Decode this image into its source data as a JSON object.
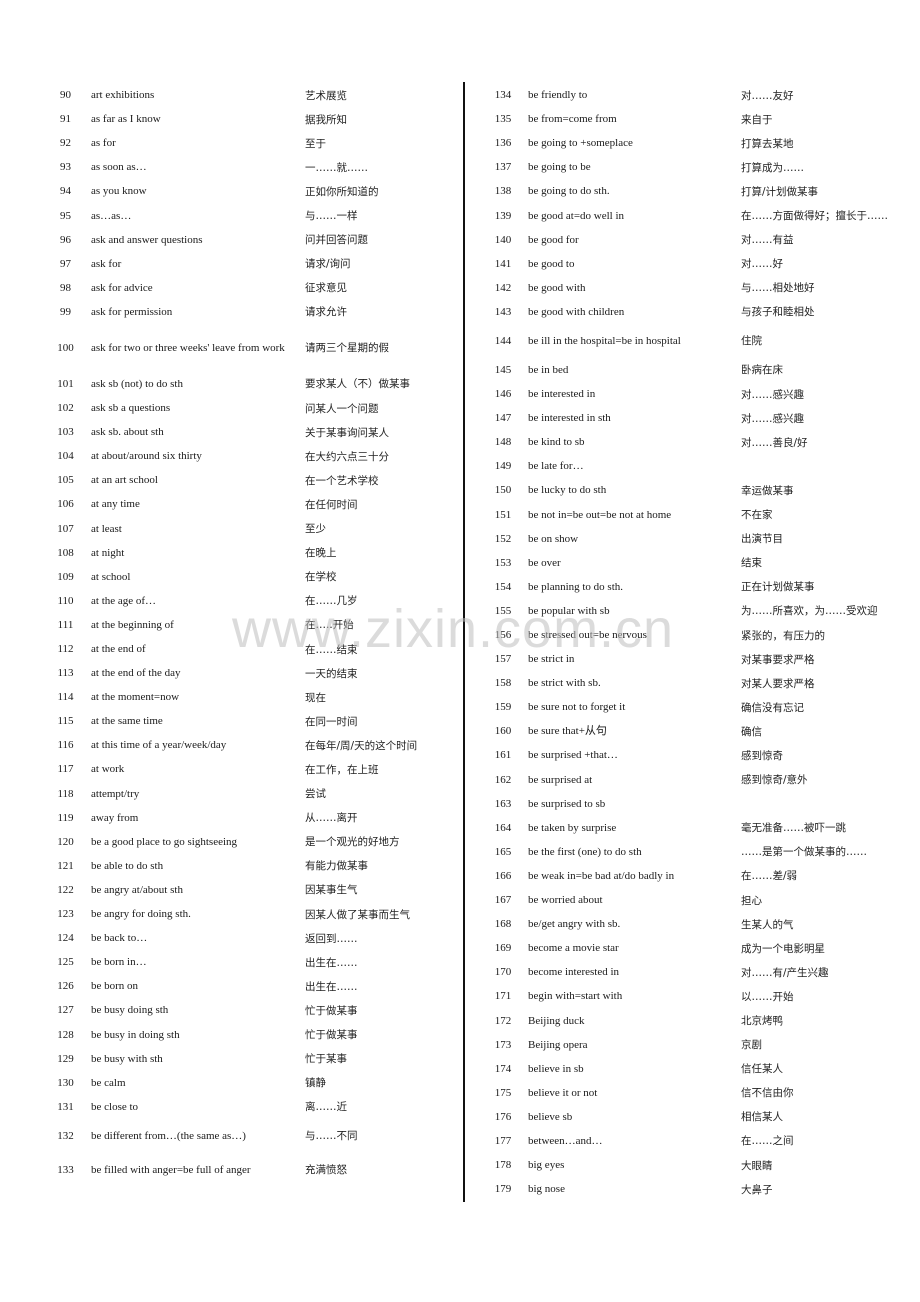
{
  "watermark": "www.zixin.com.cn",
  "left_column": [
    {
      "num": "90",
      "en": "art exhibitions",
      "zh": "艺术展览"
    },
    {
      "num": "91",
      "en": "as far as I know",
      "zh": "据我所知"
    },
    {
      "num": "92",
      "en": "as for",
      "zh": "至于"
    },
    {
      "num": "93",
      "en": "as soon as…",
      "zh": "一……就……"
    },
    {
      "num": "94",
      "en": "as you know",
      "zh": "正如你所知道的"
    },
    {
      "num": "95",
      "en": "as…as…",
      "zh": "与……一样"
    },
    {
      "num": "96",
      "en": "ask and answer questions",
      "zh": "问并回答问题"
    },
    {
      "num": "97",
      "en": "ask for",
      "zh": "请求/询问"
    },
    {
      "num": "98",
      "en": "ask for advice",
      "zh": "征求意见"
    },
    {
      "num": "99",
      "en": "ask for permission",
      "zh": "请求允许"
    },
    {
      "num": "100",
      "en": "ask for two or three weeks' leave from work",
      "zh": "请两三个星期的假",
      "tall": "tall2"
    },
    {
      "num": "101",
      "en": "ask sb (not) to do sth",
      "zh": "要求某人（不）做某事"
    },
    {
      "num": "102",
      "en": "ask sb a questions",
      "zh": "问某人一个问题"
    },
    {
      "num": "103",
      "en": "ask sb. about sth",
      "zh": "关于某事询问某人"
    },
    {
      "num": "104",
      "en": "at about/around six thirty",
      "zh": "在大约六点三十分"
    },
    {
      "num": "105",
      "en": "at an art school",
      "zh": "在一个艺术学校"
    },
    {
      "num": "106",
      "en": "at any time",
      "zh": "在任何时间"
    },
    {
      "num": "107",
      "en": "at least",
      "zh": "至少"
    },
    {
      "num": "108",
      "en": "at night",
      "zh": "在晚上"
    },
    {
      "num": "109",
      "en": "at school",
      "zh": "在学校"
    },
    {
      "num": "110",
      "en": "at the age of…",
      "zh": "在……几岁"
    },
    {
      "num": "111",
      "en": "at the beginning of",
      "zh": "在…..开始"
    },
    {
      "num": "112",
      "en": "at the end of",
      "zh": "在……结束"
    },
    {
      "num": "113",
      "en": "at the end of the day",
      "zh": "一天的结束"
    },
    {
      "num": "114",
      "en": "at the moment=now",
      "zh": "现在"
    },
    {
      "num": "115",
      "en": "at the same time",
      "zh": "在同一时间"
    },
    {
      "num": "116",
      "en": "at this time of a year/week/day",
      "zh": "在每年/周/天的这个时间"
    },
    {
      "num": "117",
      "en": "at work",
      "zh": "在工作，在上班"
    },
    {
      "num": "118",
      "en": "attempt/try",
      "zh": "尝试"
    },
    {
      "num": "119",
      "en": "away from",
      "zh": "从……离开"
    },
    {
      "num": "120",
      "en": "be a good place to go sightseeing",
      "zh": "是一个观光的好地方"
    },
    {
      "num": "121",
      "en": "be able to do sth",
      "zh": "有能力做某事"
    },
    {
      "num": "122",
      "en": "be angry at/about sth",
      "zh": "因某事生气"
    },
    {
      "num": "123",
      "en": "be angry for doing sth.",
      "zh": "因某人做了某事而生气"
    },
    {
      "num": "124",
      "en": "be back to…",
      "zh": "返回到……"
    },
    {
      "num": "125",
      "en": "be born in…",
      "zh": "出生在……"
    },
    {
      "num": "126",
      "en": "be born on",
      "zh": "出生在……"
    },
    {
      "num": "127",
      "en": "be busy doing sth",
      "zh": "忙于做某事"
    },
    {
      "num": "128",
      "en": "be busy in doing sth",
      "zh": "忙于做某事"
    },
    {
      "num": "129",
      "en": "be busy with sth",
      "zh": "忙于某事"
    },
    {
      "num": "130",
      "en": "be calm",
      "zh": "镇静"
    },
    {
      "num": "131",
      "en": "be close to",
      "zh": "离……近"
    },
    {
      "num": "132",
      "en": "be different from…(the same as…)",
      "zh": "与……不同",
      "tall": "tall1"
    },
    {
      "num": "133",
      "en": "be filled with anger=be full of anger",
      "zh": "充满愤怒",
      "tall": "tall1"
    }
  ],
  "right_column": [
    {
      "num": "134",
      "en": "be friendly to",
      "zh": "对……友好"
    },
    {
      "num": "135",
      "en": "be from=come from",
      "zh": "来自于"
    },
    {
      "num": "136",
      "en": "be going to +someplace",
      "zh": "打算去某地"
    },
    {
      "num": "137",
      "en": "be going to be",
      "zh": "打算成为……"
    },
    {
      "num": "138",
      "en": "be going to do sth.",
      "zh": "打算/计划做某事"
    },
    {
      "num": "139",
      "en": "be good at=do well in",
      "zh": "在……方面做得好；擅长于……"
    },
    {
      "num": "140",
      "en": "be good for",
      "zh": "对……有益"
    },
    {
      "num": "141",
      "en": "be good to",
      "zh": "对……好"
    },
    {
      "num": "142",
      "en": "be good with",
      "zh": "与……相处地好"
    },
    {
      "num": "143",
      "en": "be good with children",
      "zh": "与孩子和睦相处"
    },
    {
      "num": "144",
      "en": "be ill in the hospital=be in hospital",
      "zh": "住院",
      "tall": "tall1"
    },
    {
      "num": "145",
      "en": "be in bed",
      "zh": "卧病在床"
    },
    {
      "num": "146",
      "en": "be interested in",
      "zh": "对……感兴趣"
    },
    {
      "num": "147",
      "en": "be interested in sth",
      "zh": "对……感兴趣"
    },
    {
      "num": "148",
      "en": "be kind to sb",
      "zh": "对……善良/好"
    },
    {
      "num": "149",
      "en": "be late for…",
      "zh": ""
    },
    {
      "num": "150",
      "en": "be lucky to do sth",
      "zh": "幸运做某事"
    },
    {
      "num": "151",
      "en": "be not in=be out=be not at home",
      "zh": "不在家"
    },
    {
      "num": "152",
      "en": "be on show",
      "zh": "出演节目"
    },
    {
      "num": "153",
      "en": "be over",
      "zh": "结束"
    },
    {
      "num": "154",
      "en": "be planning to do sth.",
      "zh": "正在计划做某事"
    },
    {
      "num": "155",
      "en": "be popular with sb",
      "zh": "为……所喜欢，为……受欢迎"
    },
    {
      "num": "156",
      "en": "be stressed out=be nervous",
      "zh": "紧张的，有压力的"
    },
    {
      "num": "157",
      "en": "be strict in",
      "zh": "对某事要求严格"
    },
    {
      "num": "158",
      "en": "be strict with sb.",
      "zh": "对某人要求严格"
    },
    {
      "num": "159",
      "en": "be sure not to forget it",
      "zh": "确信没有忘记"
    },
    {
      "num": "160",
      "en": "be sure that+从句",
      "zh": "确信"
    },
    {
      "num": "161",
      "en": "be surprised +that…",
      "zh": "感到惊奇"
    },
    {
      "num": "162",
      "en": "be surprised at",
      "zh": "感到惊奇/意外"
    },
    {
      "num": "163",
      "en": "be surprised to sb",
      "zh": ""
    },
    {
      "num": "164",
      "en": "be taken by surprise",
      "zh": "毫无准备……被吓一跳"
    },
    {
      "num": "165",
      "en": "be the first (one) to do sth",
      "zh": "……是第一个做某事的……"
    },
    {
      "num": "166",
      "en": "be weak in=be bad at/do badly in",
      "zh": "在……差/弱"
    },
    {
      "num": "167",
      "en": "be worried about",
      "zh": "担心"
    },
    {
      "num": "168",
      "en": "be/get angry with sb.",
      "zh": "生某人的气"
    },
    {
      "num": "169",
      "en": "become a movie star",
      "zh": "成为一个电影明星"
    },
    {
      "num": "170",
      "en": "become interested in",
      "zh": "对……有/产生兴趣"
    },
    {
      "num": "171",
      "en": "begin with=start with",
      "zh": "以……开始"
    },
    {
      "num": "172",
      "en": "Beijing duck",
      "zh": "北京烤鸭"
    },
    {
      "num": "173",
      "en": "Beijing opera",
      "zh": "京剧"
    },
    {
      "num": "174",
      "en": "believe in sb",
      "zh": "信任某人"
    },
    {
      "num": "175",
      "en": "believe it or not",
      "zh": "信不信由你"
    },
    {
      "num": "176",
      "en": "believe sb",
      "zh": "相信某人"
    },
    {
      "num": "177",
      "en": "between…and…",
      "zh": "在……之间"
    },
    {
      "num": "178",
      "en": "big eyes",
      "zh": "大眼睛"
    },
    {
      "num": "179",
      "en": "big nose",
      "zh": "大鼻子"
    }
  ]
}
